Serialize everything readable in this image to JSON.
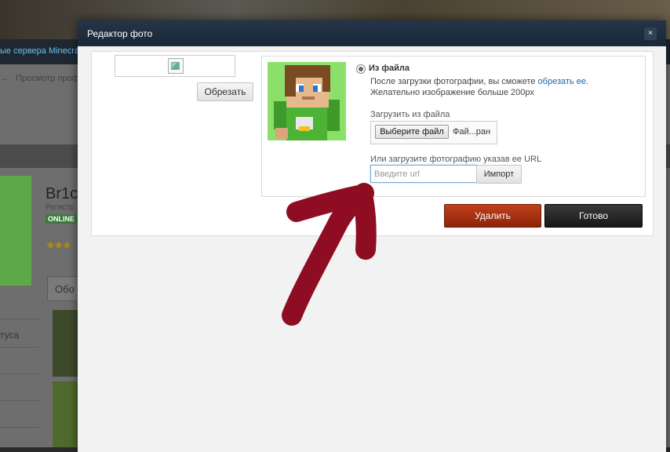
{
  "background": {
    "nav_text": "ые сервера Minecraft",
    "breadcrumb_arrow": "→",
    "breadcrumb_text": "Просмотр проф",
    "profile_name": "Br1c",
    "registered_label": "Регистр",
    "online_badge": "ONLINE",
    "stars": "★★★",
    "tab_label": "Обо",
    "status_label": "туса"
  },
  "modal": {
    "title": "Редактор фото",
    "close_symbol": "×",
    "crop_button": "Обрезать",
    "source_option": "Из файла",
    "info_line1_prefix": "После загрузки фотографии, вы сможете ",
    "info_line1_link": "обрезать ее",
    "info_line1_suffix": ".",
    "info_line2": "Желательно изображение больше 200px",
    "upload_label": "Загрузить из файла",
    "choose_file_button": "Выберите файл",
    "file_name": "Фай...ран",
    "url_label": "Или загрузите фотографию указав ее URL",
    "url_placeholder": "Введите url",
    "url_value": "",
    "import_button": "Импорт",
    "delete_button": "Удалить",
    "done_button": "Готово"
  },
  "colors": {
    "header": "#1f2e40",
    "delete": "#a8300f",
    "done": "#252525",
    "link": "#1a64a8",
    "arrow": "#8e0d22",
    "avatar_bg": "#8ce06a"
  },
  "icons": {
    "close": "close-icon",
    "broken_image": "broken-image-icon",
    "annotation": "arrow-annotation"
  }
}
